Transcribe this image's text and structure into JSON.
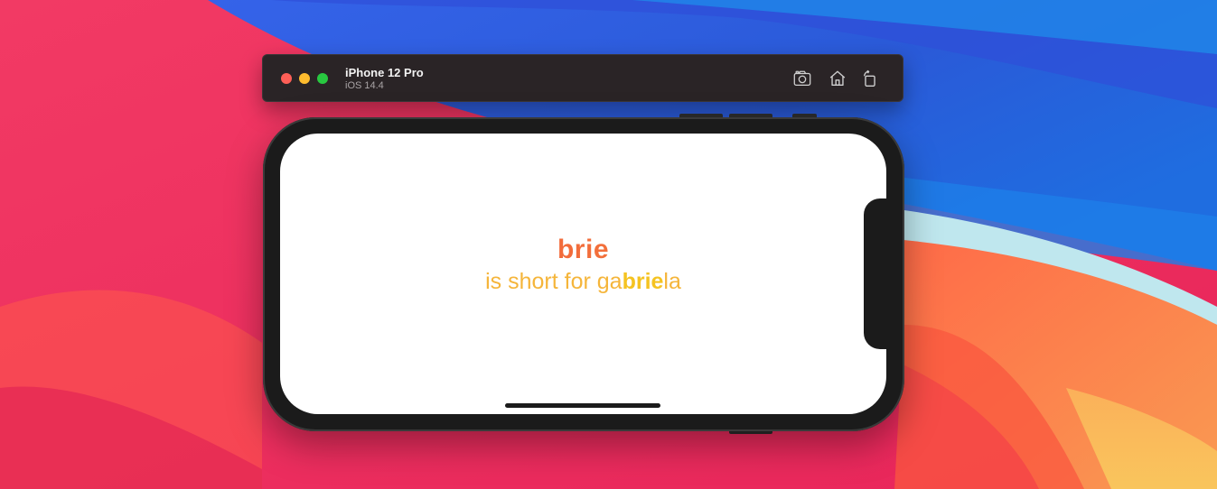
{
  "colors": {
    "accent_red": "#f0513c",
    "accent_orange": "#f58a3a",
    "accent_yellow": "#f5c321",
    "titlebar_bg": "#2a2426"
  },
  "simulator": {
    "device_name": "iPhone 12 Pro",
    "os_version": "iOS 14.4",
    "buttons": {
      "screenshot_icon": "camera-icon",
      "home_icon": "home-icon",
      "rotate_icon": "rotate-icon"
    }
  },
  "app": {
    "title": "brie",
    "subtitle_prefix": "is short for ga",
    "subtitle_highlight": "brie",
    "subtitle_suffix": "la"
  }
}
